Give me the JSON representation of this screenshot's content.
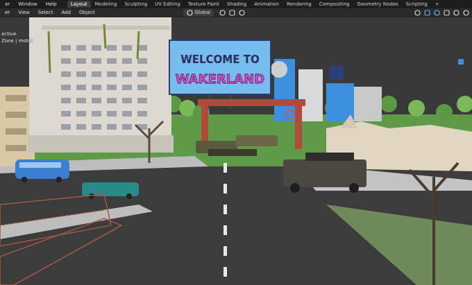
{
  "top_menu": [
    "er",
    "Window",
    "Help"
  ],
  "workspaces": [
    {
      "label": "Layout",
      "selected": true
    },
    {
      "label": "Modeling",
      "selected": false
    },
    {
      "label": "Sculpting",
      "selected": false
    },
    {
      "label": "UV Editing",
      "selected": false
    },
    {
      "label": "Texture Paint",
      "selected": false
    },
    {
      "label": "Shading",
      "selected": false
    },
    {
      "label": "Animation",
      "selected": false
    },
    {
      "label": "Rendering",
      "selected": false
    },
    {
      "label": "Compositing",
      "selected": false
    },
    {
      "label": "Geometry Nodes",
      "selected": false
    },
    {
      "label": "Scripting",
      "selected": false
    }
  ],
  "add_workspace": "+",
  "editor_menu": [
    "er",
    "View",
    "Select",
    "Add",
    "Object"
  ],
  "transform": {
    "label": "Global"
  },
  "viewport": {
    "overlay": [
      "ective",
      "Zone | motel"
    ],
    "billboard": [
      "WELCOME TO",
      "WAKERLAND"
    ]
  }
}
